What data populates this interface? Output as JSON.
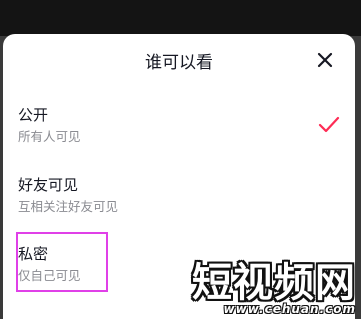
{
  "sheet": {
    "title": "谁可以看",
    "close_icon": "close-icon"
  },
  "options": [
    {
      "label": "公开",
      "sublabel": "所有人可见",
      "selected": true
    },
    {
      "label": "好友可见",
      "sublabel": "互相关注好友可见",
      "selected": false
    },
    {
      "label": "私密",
      "sublabel": "仅自己可见",
      "selected": false
    }
  ],
  "colors": {
    "check": "#fe2c55",
    "highlight": "#e040e8"
  },
  "watermark": {
    "text": "短视频网",
    "url": "www.cehuan.com"
  }
}
